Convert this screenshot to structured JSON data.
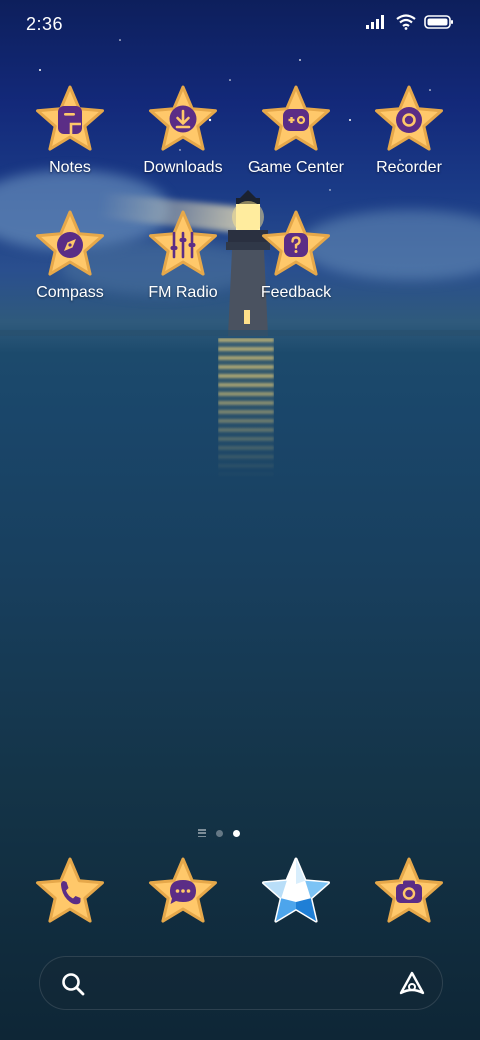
{
  "status_bar": {
    "time": "2:36",
    "icons": [
      "signal-icon",
      "wifi-icon",
      "battery-icon"
    ]
  },
  "theme": {
    "star_fill": "#ffc86a",
    "star_stroke": "#e6a84a",
    "glyph_color": "#5b2d86",
    "active_star_fill": "#3a9bea"
  },
  "apps": [
    {
      "label": "Notes",
      "icon": "notes-icon"
    },
    {
      "label": "Downloads",
      "icon": "download-icon"
    },
    {
      "label": "Game Center",
      "icon": "gamepad-icon"
    },
    {
      "label": "Recorder",
      "icon": "record-icon"
    },
    {
      "label": "Compass",
      "icon": "compass-icon"
    },
    {
      "label": "FM Radio",
      "icon": "equalizer-icon"
    },
    {
      "label": "Feedback",
      "icon": "question-icon"
    }
  ],
  "page_indicator": {
    "pages": 2,
    "current": 2
  },
  "dock": [
    {
      "icon": "phone-icon"
    },
    {
      "icon": "message-icon"
    },
    {
      "icon": "white-star-icon"
    },
    {
      "icon": "camera-icon"
    }
  ],
  "search": {
    "icon": "search-icon",
    "assistant_icon": "assistant-icon"
  }
}
